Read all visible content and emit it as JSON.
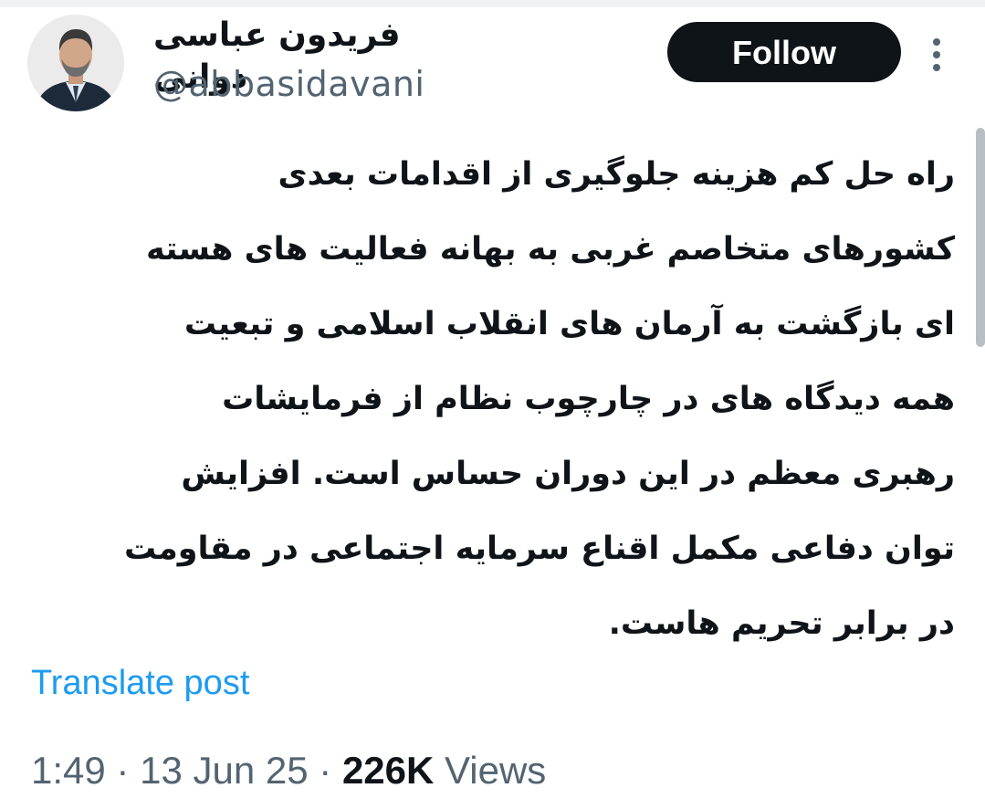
{
  "author": {
    "display_name": "فریدون عباسی دوانی",
    "handle": "@abbasidavani"
  },
  "actions": {
    "follow_label": "Follow",
    "more_icon": "more-horizontal-icon"
  },
  "tweet": {
    "lines": [
      "راه حل کم هزینه جلوگیری از اقدامات بعدی",
      "کشورهای متخاصم غربی به بهانه فعالیت های هسته",
      "ای بازگشت به آرمان های انقلاب اسلامی و تبعیت",
      "همه دیدگاه های در چارچوب نظام از فرمایشات",
      "رهبری معظم در این دوران حساس است. افزایش",
      "توان دفاعی مکمل اقناع سرمایه اجتماعی در مقاومت",
      "در برابر تحریم هاست."
    ],
    "translate_label": "Translate post"
  },
  "meta": {
    "time": "1:49",
    "separator": "·",
    "date": "13 Jun 25",
    "views_count": "226K",
    "views_label": "Views"
  },
  "colors": {
    "text_primary": "#0f1419",
    "text_secondary": "#536471",
    "link": "#1d9bf0",
    "follow_bg": "#0f1419"
  }
}
